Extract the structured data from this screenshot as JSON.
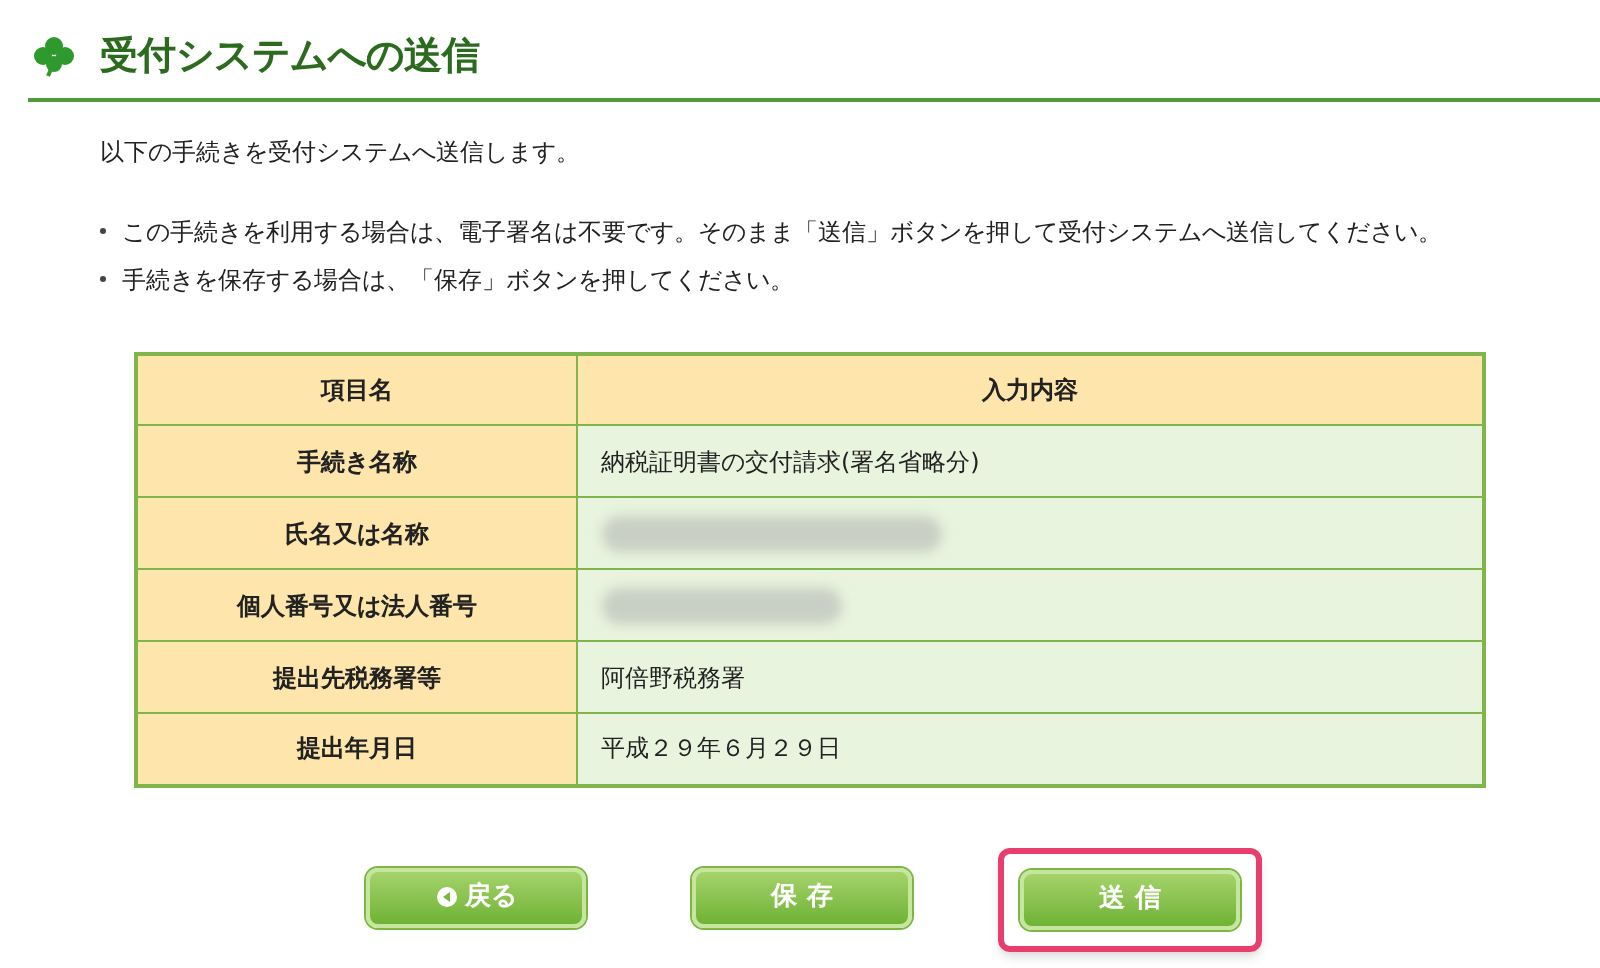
{
  "header": {
    "title": "受付システムへの送信"
  },
  "intro": "以下の手続きを受付システムへ送信します。",
  "notes": [
    "この手続きを利用する場合は、電子署名は不要です。そのまま「送信」ボタンを押して受付システムへ送信してください。",
    "手続きを保存する場合は、「保存」ボタンを押してください。"
  ],
  "table": {
    "columns": [
      "項目名",
      "入力内容"
    ],
    "rows": [
      {
        "label": "手続き名称",
        "value": "納税証明書の交付請求(署名省略分)"
      },
      {
        "label": "氏名又は名称",
        "redacted": true
      },
      {
        "label": "個人番号又は法人番号",
        "redacted": true
      },
      {
        "label": "提出先税務署等",
        "value": "阿倍野税務署"
      },
      {
        "label": "提出年月日",
        "value": "平成２９年６月２９日"
      }
    ]
  },
  "buttons": [
    {
      "label": "戻る",
      "kind": "back",
      "highlighted": false
    },
    {
      "label": "保 存",
      "kind": "plain",
      "highlighted": false
    },
    {
      "label": "送 信",
      "kind": "plain",
      "highlighted": true
    }
  ]
}
